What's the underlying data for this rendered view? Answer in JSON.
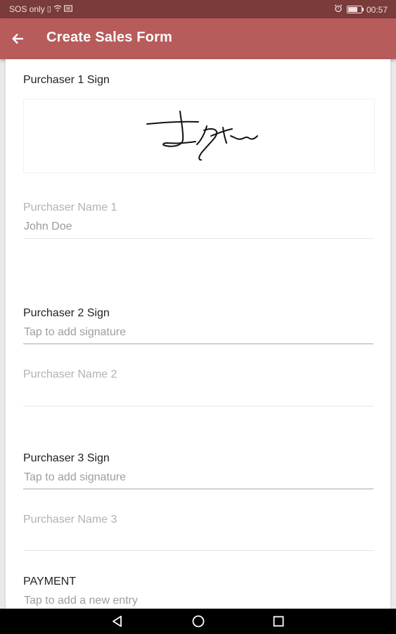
{
  "status_bar": {
    "carrier": "SOS only",
    "time": "00:57",
    "battery_level": 0.7,
    "icons": [
      "sim-icon",
      "wifi-icon",
      "message-icon",
      "alarm-icon",
      "battery-icon"
    ]
  },
  "app_bar": {
    "back_icon": "arrow-left-icon",
    "title": "Create Sales Form",
    "color": "#b75b5b"
  },
  "form": {
    "purchaser1_sign_label": "Purchaser 1 Sign",
    "purchaser1_name_label": "Purchaser Name 1",
    "purchaser1_name_value": "John Doe",
    "purchaser2_sign_label": "Purchaser 2 Sign",
    "purchaser2_sign_hint": "Tap to add signature",
    "purchaser2_name_label": "Purchaser Name 2",
    "purchaser3_sign_label": "Purchaser 3 Sign",
    "purchaser3_sign_hint": "Tap to add signature",
    "purchaser3_name_label": "Purchaser Name 3",
    "payment_label": "PAYMENT",
    "payment_hint": "Tap to add a new entry"
  },
  "nav_bar": {
    "icons": [
      "back-triangle-icon",
      "home-circle-icon",
      "recents-square-icon"
    ]
  }
}
